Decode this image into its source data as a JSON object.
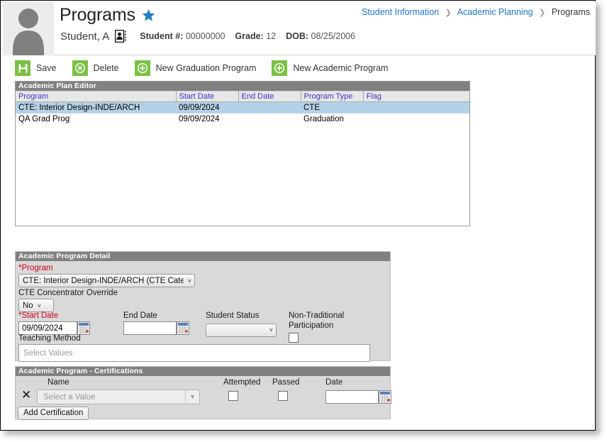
{
  "header": {
    "title": "Programs",
    "favorite_icon": "star-icon",
    "avatar_icon": "user-avatar-icon",
    "student_name": "Student, A",
    "contact_card_icon": "contact-card-icon",
    "student_number_label": "Student #:",
    "student_number_value": "00000000",
    "grade_label": "Grade:",
    "grade_value": "12",
    "dob_label": "DOB:",
    "dob_value": "08/25/2006"
  },
  "breadcrumb": {
    "items": [
      {
        "label": "Student Information",
        "current": false
      },
      {
        "label": "Academic Planning",
        "current": false
      },
      {
        "label": "Programs",
        "current": true
      }
    ],
    "separator": "❯"
  },
  "toolbar": {
    "buttons": [
      {
        "label": "Save",
        "icon": "save-floppy-icon"
      },
      {
        "label": "Delete",
        "icon": "delete-circle-x-icon"
      },
      {
        "label": "New Graduation Program",
        "icon": "add-circle-plus-icon"
      },
      {
        "label": "New Academic Program",
        "icon": "add-circle-plus-icon"
      }
    ],
    "accent_color": "#7ac143"
  },
  "plan_editor": {
    "title": "Academic Plan Editor",
    "columns": [
      "Program",
      "Start Date",
      "End Date",
      "Program Type",
      "Flag"
    ],
    "rows": [
      {
        "program": "CTE: Interior Design-INDE/ARCH",
        "start_date": "09/09/2024",
        "end_date": "",
        "program_type": "CTE",
        "flag": "",
        "selected": true
      },
      {
        "program": "QA Grad Prog",
        "start_date": "09/09/2024",
        "end_date": "",
        "program_type": "Graduation",
        "flag": "",
        "selected": false
      }
    ],
    "selected_row_color": "#b4d2e7",
    "header_text_color": "#3b34c9"
  },
  "program_detail": {
    "title": "Academic Program Detail",
    "program_label": "*Program",
    "program_value": "CTE: Interior Design-INDE/ARCH (CTE Category",
    "concentrator_label": "CTE Concentrator Override",
    "concentrator_value": "No",
    "start_date_label": "*Start Date",
    "start_date_value": "09/09/2024",
    "end_date_label": "End Date",
    "end_date_value": "",
    "student_status_label": "Student Status",
    "student_status_value": "",
    "non_traditional_label": "Non-Traditional Participation",
    "non_traditional_checked": false,
    "teaching_method_label": "Teaching Method",
    "teaching_method_placeholder": "Select Values",
    "required_marker_color": "#d0021b"
  },
  "certifications": {
    "title": "Academic Program - Certifications",
    "columns": {
      "name": "Name",
      "attempted": "Attempted",
      "passed": "Passed",
      "date": "Date"
    },
    "row": {
      "remove_icon": "remove-x-icon",
      "name_placeholder": "Select a Value",
      "attempted_checked": false,
      "passed_checked": false,
      "date_value": ""
    },
    "add_button_label": "Add Certification"
  }
}
